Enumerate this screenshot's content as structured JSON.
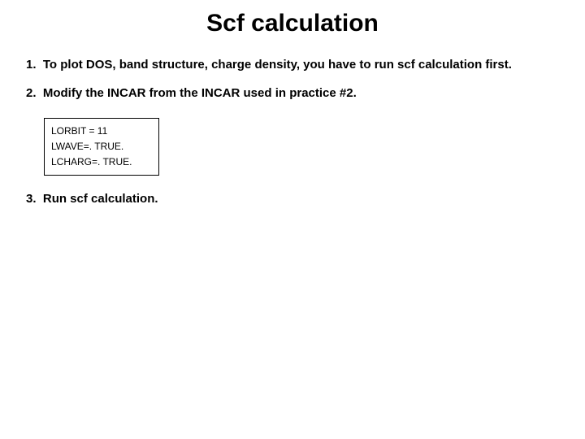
{
  "title": "Scf calculation",
  "items": [
    {
      "number": "1.",
      "text": "To plot DOS, band structure, charge density, you have to run scf calculation first."
    },
    {
      "number": "2.",
      "text": "Modify the INCAR from the INCAR used in practice #2."
    },
    {
      "number": "3.",
      "text": "Run scf calculation."
    }
  ],
  "code": {
    "line1": "LORBIT = 11",
    "line2": "LWAVE=. TRUE.",
    "line3": "LCHARG=. TRUE."
  }
}
